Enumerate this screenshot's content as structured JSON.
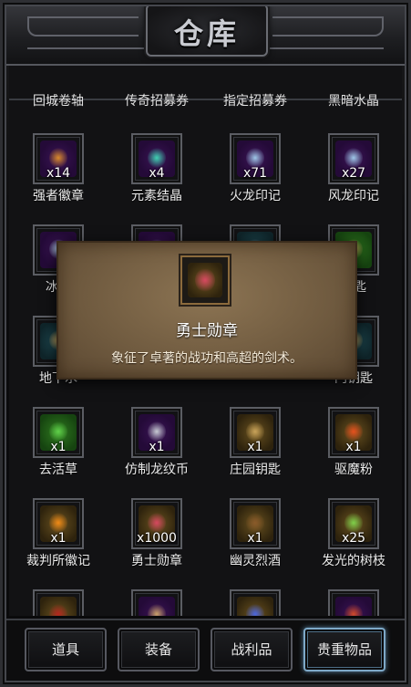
{
  "header": {
    "title": "仓库"
  },
  "top_row": [
    "回城卷轴",
    "传奇招募券",
    "指定招募券",
    "黑暗水晶"
  ],
  "rows": [
    [
      {
        "name": "强者徽章",
        "qty": "x14",
        "icon": "strong-badge-icon",
        "bg": "purple",
        "color": "#d98a2a"
      },
      {
        "name": "元素结晶",
        "qty": "x4",
        "icon": "element-crystal-icon",
        "bg": "purple",
        "color": "#3fd1b2"
      },
      {
        "name": "火龙印记",
        "qty": "x71",
        "icon": "fire-dragon-mark-icon",
        "bg": "purple",
        "color": "#9fc8e8"
      },
      {
        "name": "风龙印记",
        "qty": "x27",
        "icon": "wind-dragon-mark-icon",
        "bg": "purple",
        "color": "#9fc8e8"
      }
    ],
    [
      {
        "name": "冰龙",
        "qty": "",
        "icon": "ice-dragon-mark-icon",
        "bg": "purple",
        "color": "#b8d9f0"
      },
      {
        "name": "",
        "qty": "",
        "icon": "unknown-item-icon",
        "bg": "purple",
        "color": "#7a8fa6"
      },
      {
        "name": "",
        "qty": "",
        "icon": "unknown-item-icon",
        "bg": "teal",
        "color": "#7a8fa6"
      },
      {
        "name": "钥匙",
        "qty": "",
        "icon": "key-icon",
        "bg": "green",
        "color": "#c9a35a"
      }
    ],
    [
      {
        "name": "地下水",
        "qty": "",
        "icon": "key-icon",
        "bg": "teal",
        "color": "#c9a35a"
      },
      {
        "name": "",
        "qty": "",
        "icon": "unknown-item-icon",
        "bg": "purple",
        "color": "#7a8fa6"
      },
      {
        "name": "",
        "qty": "",
        "icon": "unknown-item-icon",
        "bg": "purple",
        "color": "#7a8fa6"
      },
      {
        "name": "门钥匙",
        "qty": "",
        "icon": "key-icon",
        "bg": "teal",
        "color": "#c9a35a"
      }
    ],
    [
      {
        "name": "去活草",
        "qty": "x1",
        "icon": "herb-icon",
        "bg": "green",
        "color": "#5fd04a"
      },
      {
        "name": "仿制龙纹币",
        "qty": "x1",
        "icon": "dragon-coin-icon",
        "bg": "purple",
        "color": "#c7cbd3"
      },
      {
        "name": "庄园钥匙",
        "qty": "x1",
        "icon": "manor-key-icon",
        "bg": "gold",
        "color": "#c9a35a"
      },
      {
        "name": "驱魔粉",
        "qty": "x1",
        "icon": "exorcism-powder-icon",
        "bg": "gold",
        "color": "#e6501d"
      }
    ],
    [
      {
        "name": "裁判所徽记",
        "qty": "x1",
        "icon": "tribunal-emblem-icon",
        "bg": "gold",
        "color": "#f08a16"
      },
      {
        "name": "勇士勋章",
        "qty": "x1000",
        "icon": "warrior-medal-icon",
        "bg": "gold",
        "color": "#d64860"
      },
      {
        "name": "幽灵烈酒",
        "qty": "x1",
        "icon": "ghost-liquor-icon",
        "bg": "gold",
        "color": "#8a5a2a"
      },
      {
        "name": "发光的树枝",
        "qty": "x25",
        "icon": "glowing-branch-icon",
        "bg": "gold",
        "color": "#7ed04a"
      }
    ],
    [
      {
        "name": "",
        "qty": "",
        "icon": "red-item-icon",
        "bg": "gold",
        "color": "#b3261e"
      },
      {
        "name": "",
        "qty": "",
        "icon": "scroll-item-icon",
        "bg": "purple",
        "color": "#c9a06a"
      },
      {
        "name": "",
        "qty": "",
        "icon": "blue-flame-item-icon",
        "bg": "gold",
        "color": "#4a66e0"
      },
      {
        "name": "",
        "qty": "",
        "icon": "red-gem-item-icon",
        "bg": "purple",
        "color": "#d04a2a"
      }
    ]
  ],
  "popup": {
    "name": "勇士勋章",
    "description": "象征了卓著的战功和高超的剑术。",
    "icon": "warrior-medal-icon",
    "color": "#d64860"
  },
  "tabs": [
    {
      "label": "道具",
      "active": false
    },
    {
      "label": "装备",
      "active": false
    },
    {
      "label": "战利品",
      "active": false
    },
    {
      "label": "贵重物品",
      "active": true
    }
  ]
}
